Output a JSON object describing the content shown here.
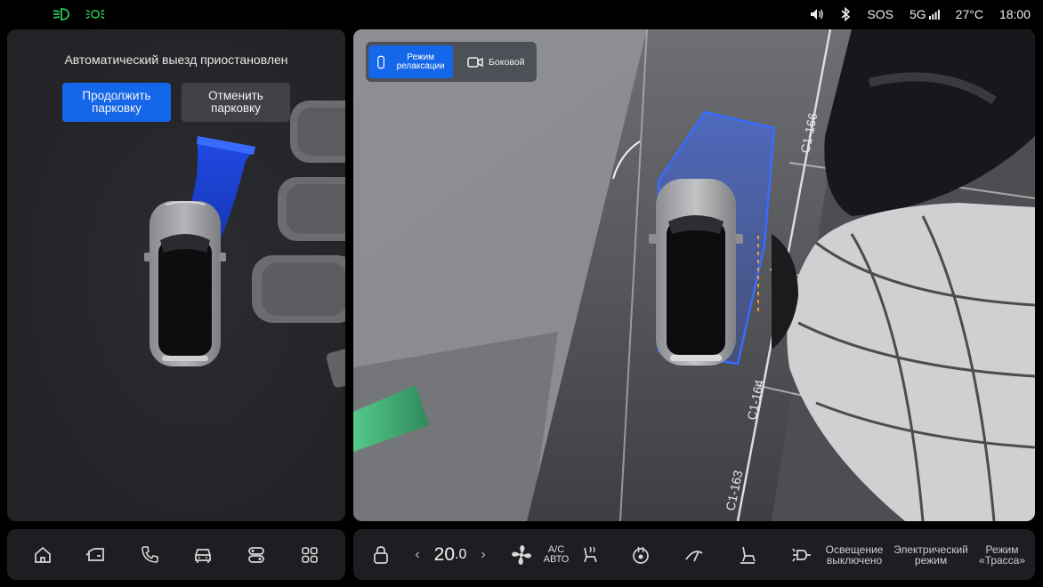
{
  "status_bar": {
    "indicators": [
      {
        "icon": "low-beam-icon",
        "color": "#28c85a"
      },
      {
        "icon": "parking-lights-icon",
        "color": "#28c85a"
      }
    ],
    "volume_icon": "volume-icon",
    "bluetooth_icon": "bluetooth-icon",
    "sos": "SOS",
    "network": "5G",
    "temperature": "27°C",
    "time": "18:00"
  },
  "parking": {
    "message": "Автоматический выезд приостановлен",
    "continue_button": "Продолжить парковку",
    "cancel_button": "Отменить парковку",
    "accent_color": "#1467e8"
  },
  "camera": {
    "modes": [
      {
        "label": "Режим релаксации",
        "icon": "car-top-icon",
        "active": true
      },
      {
        "label": "Боковой",
        "icon": "camera-icon",
        "active": false
      }
    ],
    "spot_labels": [
      "C1-166",
      "C1-164",
      "C1-163"
    ]
  },
  "dock": {
    "items": [
      {
        "icon": "home-icon"
      },
      {
        "icon": "car-door-icon"
      },
      {
        "icon": "phone-icon"
      },
      {
        "icon": "car-icon"
      },
      {
        "icon": "controls-icon"
      },
      {
        "icon": "apps-grid-icon"
      }
    ]
  },
  "climate": {
    "lock_icon": "lock-icon",
    "temperature_int": "20",
    "temperature_dec": ".0",
    "left_arrow": "‹",
    "right_arrow": "›",
    "fan_icon": "fan-icon",
    "ac_label_1": "A/C",
    "ac_label_2": "АВТО",
    "seat_heat_icon": "seat-heat-icon",
    "steering_heat_icon": "steering-heat-icon",
    "wiper_icon": "wiper-icon",
    "seat_adjust_icon": "seat-adjust-icon",
    "charge_icon": "charging-plug-icon",
    "lights_label": "Освещение выключено",
    "electric_label": "Электрический режим",
    "highway_label": "Режим «Трасса»"
  }
}
